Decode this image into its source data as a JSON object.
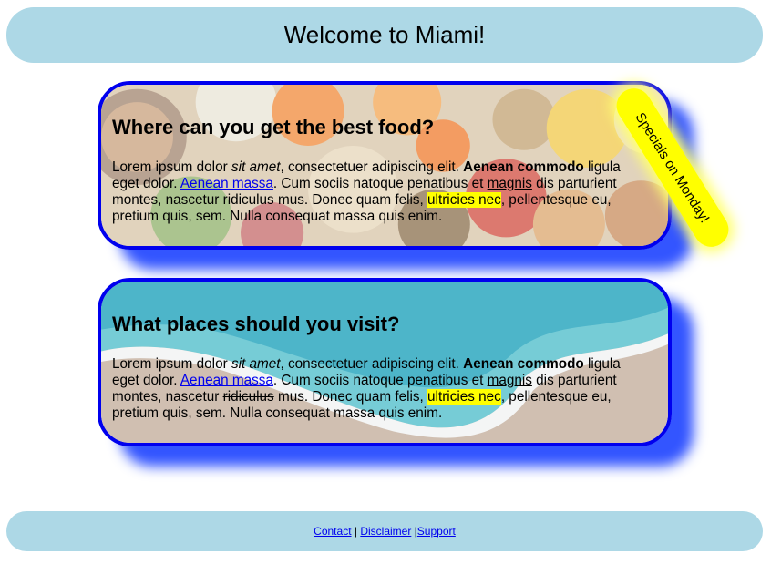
{
  "header": {
    "title": "Welcome to Miami!"
  },
  "sections": [
    {
      "title": "Where can you get the best food?",
      "background": "vegetables-and-fruit-photo",
      "paragraph": {
        "t1": "Lorem ipsum dolor ",
        "em": "sit amet",
        "t2": ", consectetuer adipiscing elit. ",
        "strong": "Aenean commodo",
        "t3": " ligula eget dolor. ",
        "link": "Aenean massa",
        "t4": ". Cum sociis natoque penatibus et ",
        "underline": "magnis",
        "t5": " dis parturient montes, nascetur ",
        "strike": "ridiculus",
        "t6": " mus. Donec quam felis, ",
        "highlight": "ultricies nec",
        "t7": ", pellentesque eu, pretium quis, sem. Nulla consequat massa quis enim."
      }
    },
    {
      "title": "What places should you visit?",
      "background": "beach-shoreline-photo",
      "paragraph": {
        "t1": "Lorem ipsum dolor ",
        "em": "sit amet",
        "t2": ", consectetuer adipiscing elit. ",
        "strong": "Aenean commodo",
        "t3": " ligula eget dolor. ",
        "link": "Aenean massa",
        "t4": ". Cum sociis natoque penatibus et ",
        "underline": "magnis",
        "t5": " dis parturient montes, nascetur ",
        "strike": "ridiculus",
        "t6": " mus. Donec quam felis, ",
        "highlight": "ultricies nec",
        "t7": ", pellentesque eu, pretium quis, sem. Nulla consequat massa quis enim."
      }
    }
  ],
  "badge": {
    "text": "Specials on Monday!"
  },
  "footer": {
    "links": [
      "Contact",
      "Disclaimer",
      "Support"
    ],
    "sep1": " | ",
    "sep2": " |"
  },
  "colors": {
    "header_bg": "#add8e6",
    "card_border": "#0000ee",
    "card_shadow": "#3355ff",
    "badge_bg": "#ffff00",
    "highlight": "#ffff00",
    "link": "#0000ee"
  }
}
